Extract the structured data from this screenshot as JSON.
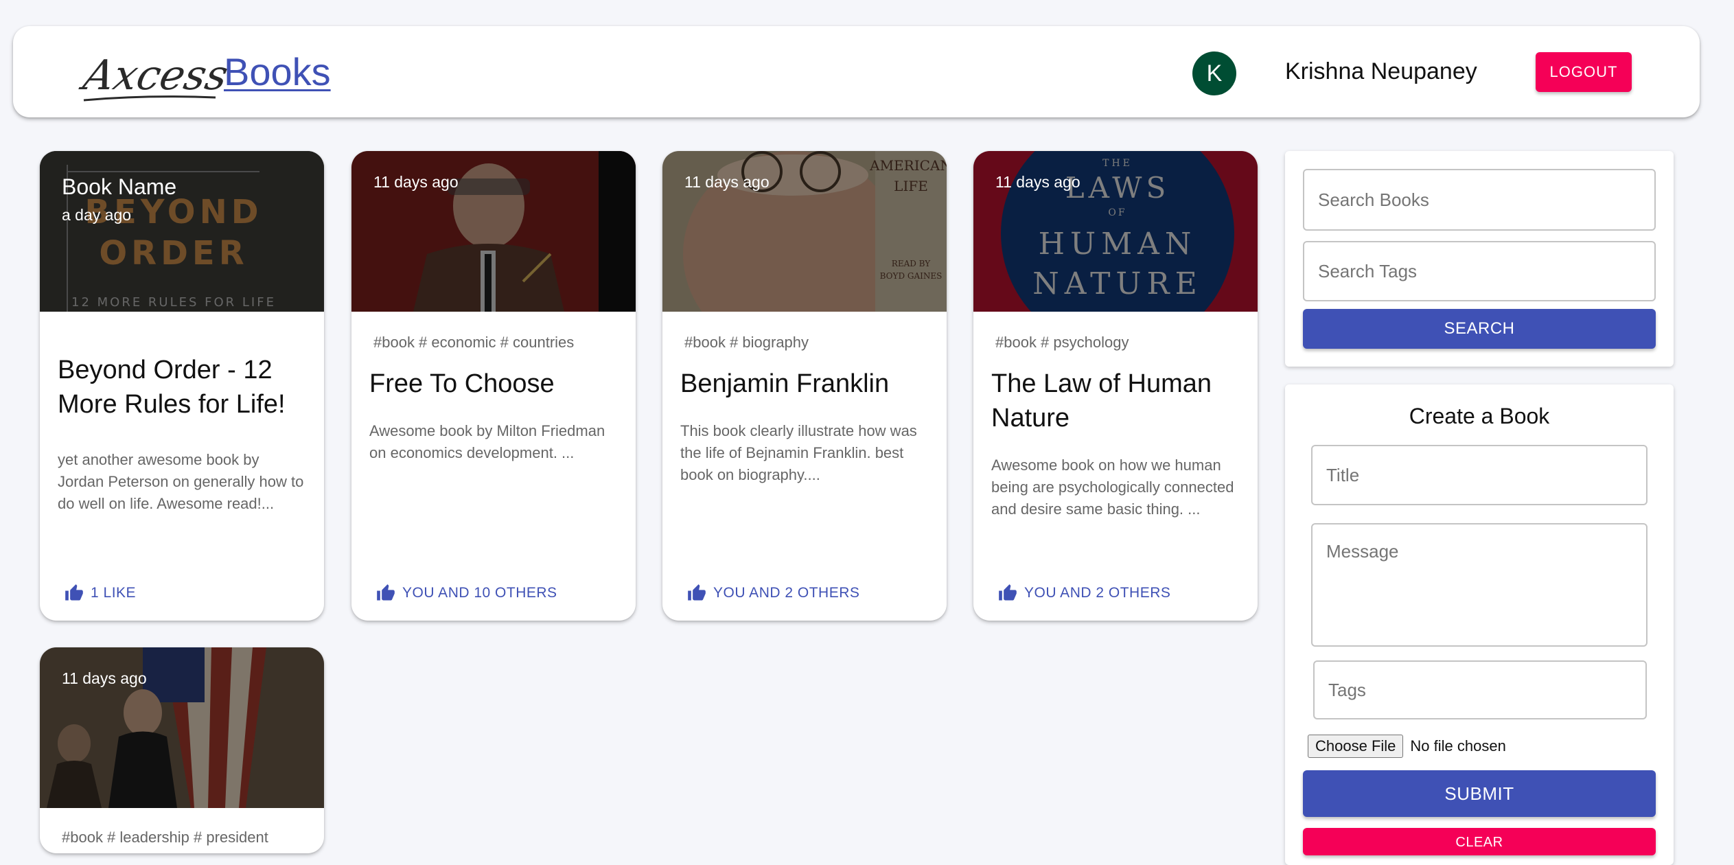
{
  "header": {
    "logo_text": "Axcess",
    "brand_link": "Books",
    "avatar_initial": "K",
    "username": "Krishna Neupaney",
    "logout_label": "LOGOUT"
  },
  "posts": [
    {
      "overlay_title": "Book Name",
      "time": "a day ago",
      "tags": "",
      "title": "Beyond Order - 12 More Rules for Life!",
      "message": "yet another awesome book by Jordan Peterson on generally how to do well on life. Awesome read!...",
      "likes": "1 LIKE",
      "cover_text": [
        "BEYOND",
        "ORDER",
        "12 MORE RULES FOR LIFE"
      ]
    },
    {
      "overlay_title": "",
      "time": "11 days ago",
      "tags": "#book # economic # countries",
      "title": "Free To Choose",
      "message": "Awesome book by Milton Friedman on economics development. ...",
      "likes": "YOU AND 10 OTHERS"
    },
    {
      "overlay_title": "",
      "time": "11 days ago",
      "tags": "#book # biography",
      "title": "Benjamin Franklin",
      "message": "This book clearly illustrate how was the life of Bejnamin Franklin. best book on biography....",
      "likes": "YOU AND 2 OTHERS",
      "cover_text": [
        "AMERICAN",
        "LIFE",
        "READ BY",
        "BOYD GAINES"
      ]
    },
    {
      "overlay_title": "",
      "time": "11 days ago",
      "tags": "#book # psychology",
      "title": "The Law of Human Nature",
      "message": "Awesome book on how we human being are psychologically connected and desire same basic thing. ...",
      "likes": "YOU AND 2 OTHERS",
      "cover_text": [
        "THE",
        "LAWS",
        "OF",
        "HUMAN",
        "NATURE"
      ]
    },
    {
      "overlay_title": "",
      "time": "11 days ago",
      "tags": "#book # leadership # president",
      "title": "",
      "message": "",
      "likes": ""
    }
  ],
  "search": {
    "books_placeholder": "Search Books",
    "tags_placeholder": "Search Tags",
    "button": "SEARCH"
  },
  "form": {
    "title": "Create a Book",
    "title_placeholder": "Title",
    "message_placeholder": "Message",
    "tags_placeholder": "Tags",
    "file_button": "Choose File",
    "file_status": "No file chosen",
    "submit": "SUBMIT",
    "clear": "CLEAR"
  },
  "colors": {
    "primary": "#3f51b5",
    "secondary": "#f50057",
    "avatar": "#004d33",
    "background": "#f5f6fa"
  }
}
